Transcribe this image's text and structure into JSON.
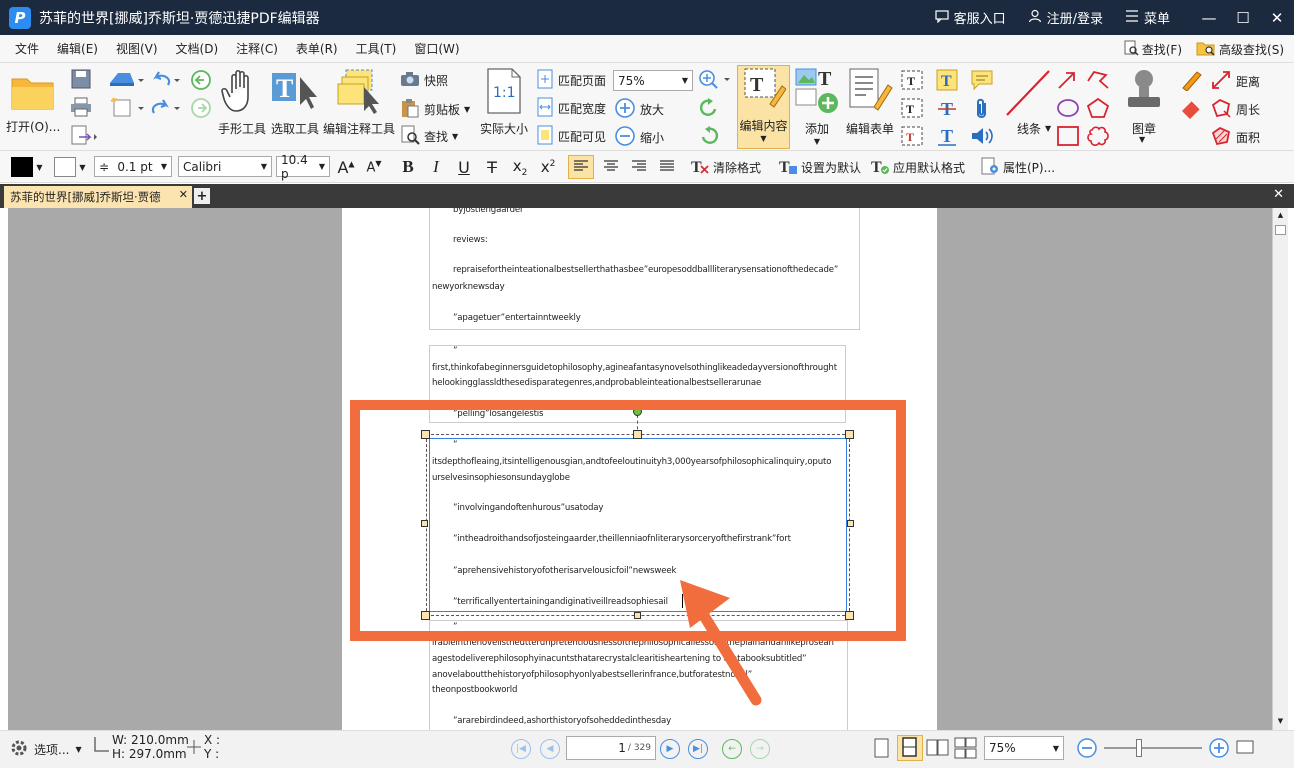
{
  "window": {
    "title": "苏菲的世界[挪威]乔斯坦·贾德迅捷PDF编辑器",
    "support": "客服入口",
    "login": "注册/登录",
    "menu": "菜单"
  },
  "menubar": {
    "items": [
      "文件",
      "编辑(E)",
      "视图(V)",
      "文档(D)",
      "注释(C)",
      "表单(R)",
      "工具(T)",
      "窗口(W)"
    ],
    "find": "查找(F)",
    "advanced_find": "高级查找(S)"
  },
  "ribbon": {
    "open": "打开(O)...",
    "hand_tool": "手形工具",
    "select_text": "选取工具",
    "edit_annotation": "编辑注释工具",
    "snapshot": "快照",
    "clipboard": "剪贴板",
    "search": "查找",
    "actual_size": "实际大小",
    "fit_page": "匹配页面",
    "fit_width": "匹配宽度",
    "fit_visible": "匹配可见",
    "zoom_value": "75%",
    "zoom_in": "放大",
    "zoom_out": "缩小",
    "edit_content": "编辑内容",
    "add": "添加",
    "edit_form": "编辑表单",
    "line": "线条",
    "stamp": "图章",
    "distance": "距离",
    "perimeter": "周长",
    "area": "面积"
  },
  "format": {
    "line_width": "0.1 pt",
    "font": "Calibri",
    "font_size": "10.4 p",
    "clear_format": "清除格式",
    "set_default": "设置为默认",
    "apply_default": "应用默认格式",
    "properties": "属性(P)..."
  },
  "tab": {
    "label": "苏菲的世界[挪威]乔斯坦·贾德"
  },
  "document": {
    "box1": [
      "byjostiengaarder",
      "reviews:",
      "repraisefortheinteationalbestsellerthathasbee”europesoddballliterarysensationofthedecade”",
      "newyorknewsday",
      "”apagetuer”entertainntweekly"
    ],
    "box2": [
      "”",
      "first,thinkofabeginnersguidetophilosophy,agineafantasynovelsothinglikeadedayversionofthrought",
      "helookingglassldthesedisparategenres,andprobableinteationalbestsellerarunae",
      "”pelling”losangelestis"
    ],
    "box3": [
      "”",
      "itsdepthofleaing,itsintelligenousgian,andtofeeloutinuityh3,000yearsofphilosophicalinquiry,oputo",
      "urselvesinsophiesonsundayglobe",
      "”involvingandoftenhurous”usatoday",
      "”intheadroithandsofjosteingaarder,theillenniaofnliterarysorceryofthefirstrank”fort",
      "”aprehensivehistoryofotherisarvelousicfoil”newsweek",
      "”terrificallyentertainingandiginativeillreadsophiesail"
    ],
    "box4": [
      "”",
      "irableinthenovelistheutterunpretentiousnessofthephilosophicallessons,theplainandanlikeprosean",
      "agestodeliverephilosophyinacuntsthatarecrystalclearitisheartening to thatabooksubtitled”",
      "anovelaboutthehistoryofphilosophyonlyabestsellerinfrance,butforatestnovel”",
      "theonpostbookworld",
      "”ararebirdindeed,ashorthistoryofsoheddedinthesday"
    ]
  },
  "status": {
    "options": "选项...",
    "width": "W: 210.0mm",
    "height": "H: 297.0mm",
    "x": "X :",
    "y": "Y :",
    "page_current": "1",
    "page_total": "/ 329",
    "zoom": "75%"
  },
  "colors": {
    "titlebar": "#1c2a3f",
    "highlight": "#f26d3d",
    "selection": "#3a7fe0",
    "tab_active": "#fce4b0"
  }
}
